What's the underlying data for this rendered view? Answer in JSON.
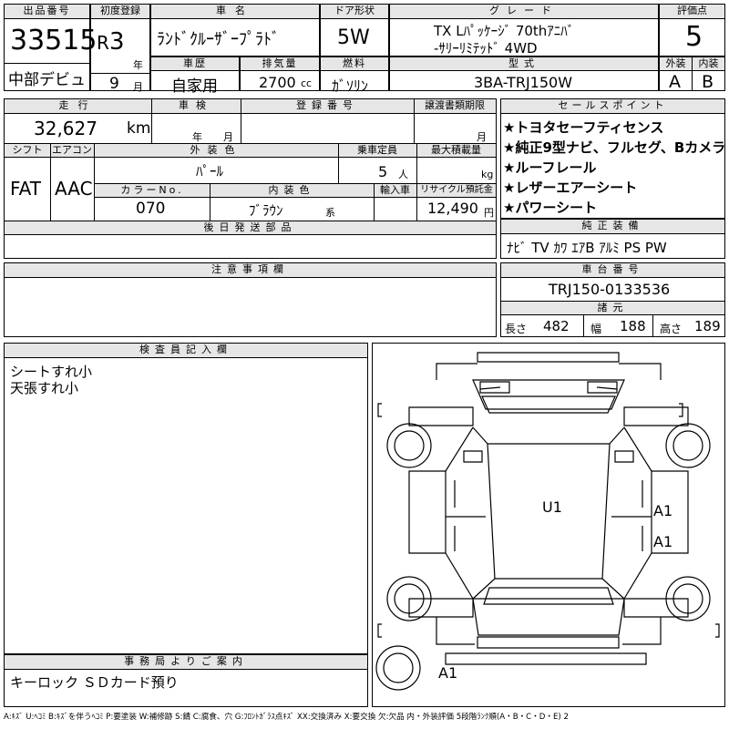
{
  "labels": {
    "lot_no": "出品番号",
    "first_reg": "初度登録",
    "car_name": "車名",
    "door": "ドア形状",
    "grade": "グレード",
    "score": "評価点",
    "year_unit": "年",
    "history": "車歴",
    "displacement": "排気量",
    "fuel": "燃料",
    "model": "型式",
    "exterior": "外装",
    "interior": "内装",
    "month_unit": "月",
    "mileage": "走行",
    "inspection": "車検",
    "reg_no": "登録番号",
    "transfer_doc": "譲渡書類期限",
    "year_small": "年",
    "month_small": "月",
    "shift": "シフト",
    "aircon": "エアコン",
    "ext_color": "外装色",
    "capacity": "乗車定員",
    "max_load": "最大積載量",
    "color_no": "カラーNo.",
    "int_color": "内装色",
    "import": "輸入車",
    "recycle": "リサイクル預託金",
    "later_parts": "後日発送部品",
    "sales_points": "セールスポイント",
    "genuine": "純正装備",
    "notes": "注意事項欄",
    "chassis": "車台番号",
    "specs": "諸元",
    "inspector": "検査員記入欄",
    "office": "事務局よりご案内",
    "length": "長さ",
    "width": "幅",
    "height": "高さ"
  },
  "values": {
    "lot_no": "33515",
    "venue": "中部デビュ",
    "era": "R",
    "year": "3",
    "month": "9",
    "car_name": "ﾗﾝﾄﾞｸﾙｰｻﾞｰﾌﾟﾗﾄﾞ",
    "door": "5W",
    "grade_line1": "TX Lﾊﾟｯｹｰｼﾞ 70thｱﾆﾊﾞ",
    "grade_line2": "-ｻﾘｰﾘﾐﾃｯﾄﾞ 4WD",
    "score": "5",
    "history": "自家用",
    "displacement": "2700",
    "cc": "cc",
    "fuel": "ｶﾞｿﾘﾝ",
    "model": "3BA-TRJ150W",
    "exterior": "A",
    "interior": "B",
    "mileage": "32,627",
    "km": "km",
    "shift": "FAT",
    "aircon": "AAC",
    "ext_color": "ﾊﾟｰﾙ",
    "capacity": "5",
    "capacity_unit": "人",
    "kg": "kg",
    "color_no": "070",
    "int_color": "ﾌﾞﾗｳﾝ",
    "int_suffix": "系",
    "recycle": "12,490",
    "yen": "円",
    "chassis": "TRJ150-0133536",
    "length": "482",
    "width": "188",
    "height": "189",
    "genuine": "ﾅﾋﾞ TV ｶﾜ ｴｱB ｱﾙﾐ PS PW",
    "inspector_line1": "シートすれ小",
    "inspector_line2": "天張すれ小",
    "office_text": "キーロック ＳＤカード預り",
    "legend": "A:ｷｽﾞ U:ﾍｺﾐ B:ｷｽﾞを伴うﾍｺﾐ P:要塗装 W:補修跡 S:錆 C:腐食、穴 G:ﾌﾛﾝﾄｶﾞﾗｽ点ｷｽﾞ XX:交換済み X:要交換 欠:欠品 内・外装評価 5段階ﾗﾝｸ順(A・B・C・D・E) 2"
  },
  "sales_points": [
    "★トヨタセーフティセンス",
    "★純正9型ナビ、フルセグ、Bカメラ",
    "★ルーフレール",
    "★レザーエアーシート",
    "★パワーシート"
  ],
  "diagram_marks": {
    "roof": "U1",
    "right_front": "A1",
    "right_rear": "A1",
    "spare": "A1"
  }
}
